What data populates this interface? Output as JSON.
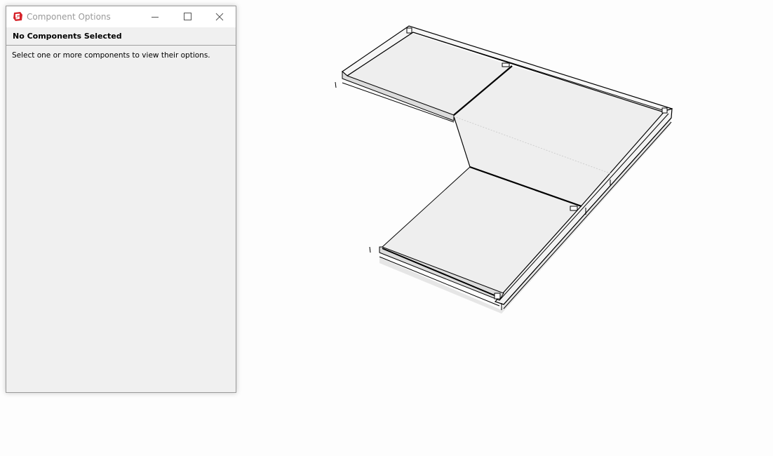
{
  "window": {
    "title": "Component Options",
    "app_icon": "sketchup-icon",
    "controls": {
      "minimize_icon": "minimize-icon",
      "maximize_icon": "maximize-icon",
      "close_icon": "close-icon"
    }
  },
  "panel": {
    "header": "No Components Selected",
    "message": "Select one or more components to view their options."
  },
  "colors": {
    "app_icon_red": "#d6232a",
    "window_background": "#f0f0f0",
    "title_text": "#9a9a9a",
    "model_face": "#eeeeee",
    "model_edge": "#000000"
  }
}
